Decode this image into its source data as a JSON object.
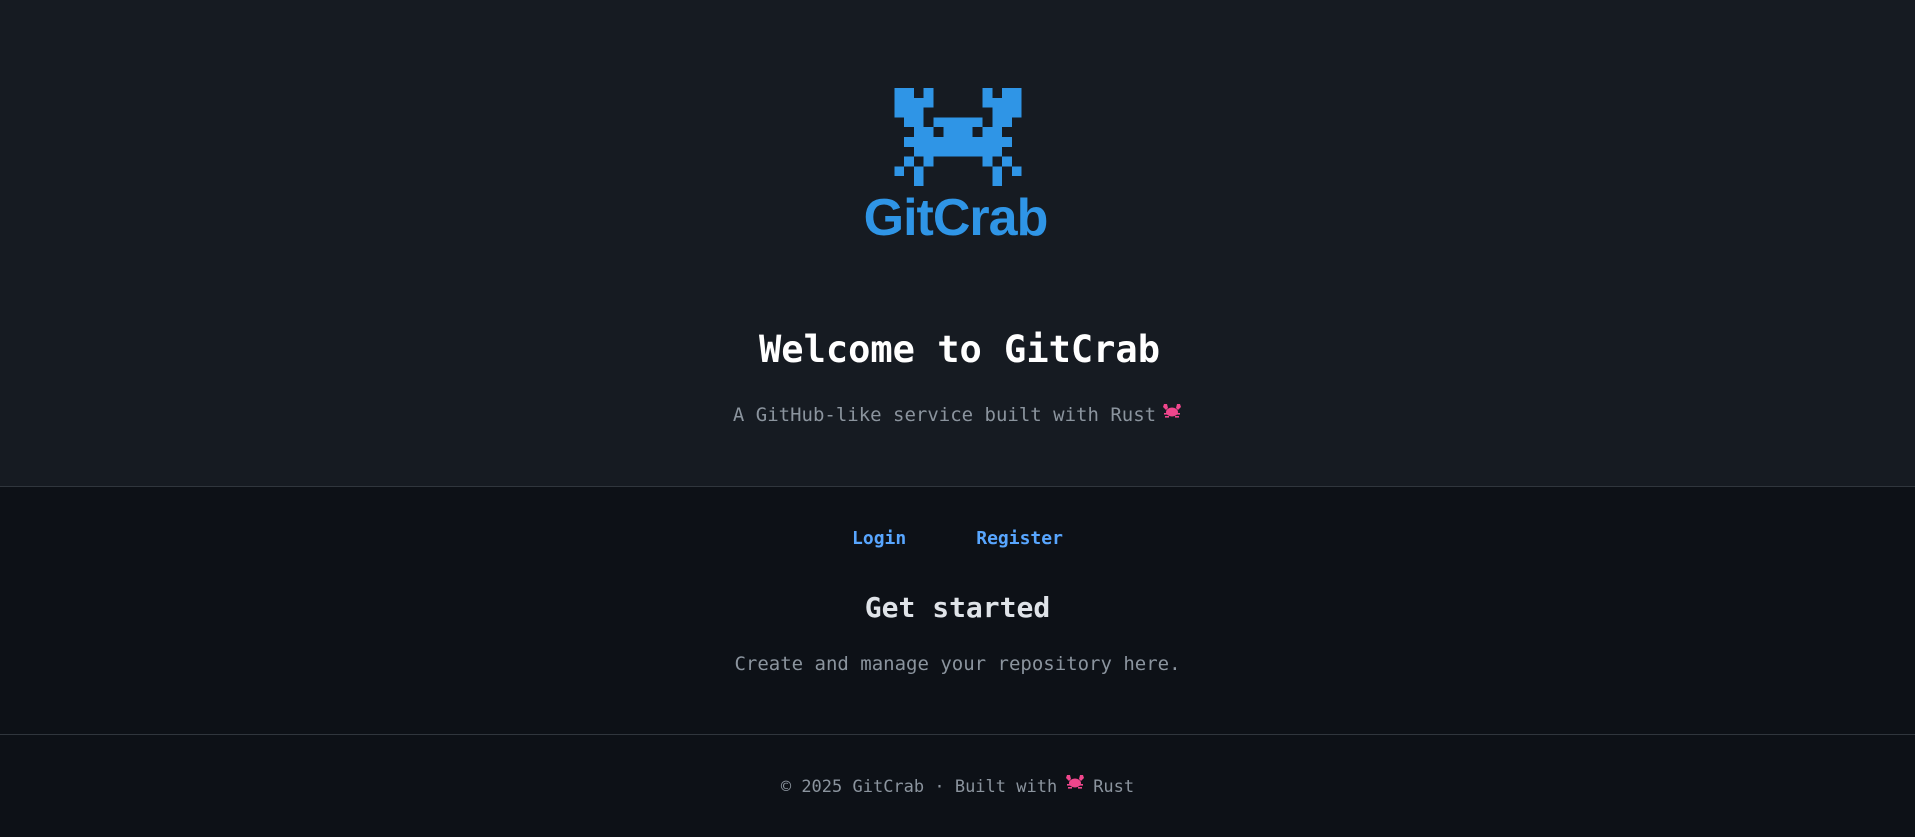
{
  "brand": {
    "name": "GitCrab",
    "logo_icon": "crab-icon",
    "color": "#2f95e6"
  },
  "hero": {
    "title": "Welcome to GitCrab",
    "tagline": "A GitHub-like service built with Rust",
    "tagline_icon": "crab-emoji-icon"
  },
  "nav": {
    "login_label": "Login",
    "register_label": "Register",
    "link_color": "#58a6ff"
  },
  "main": {
    "heading": "Get started",
    "text": "Create and manage your repository here."
  },
  "footer": {
    "prefix": "© 2025 GitCrab · Built with",
    "suffix": "Rust",
    "icon": "crab-emoji-icon"
  },
  "colors": {
    "background": "#161b22",
    "panel": "#0d1117",
    "emoji": "#f0468c"
  }
}
